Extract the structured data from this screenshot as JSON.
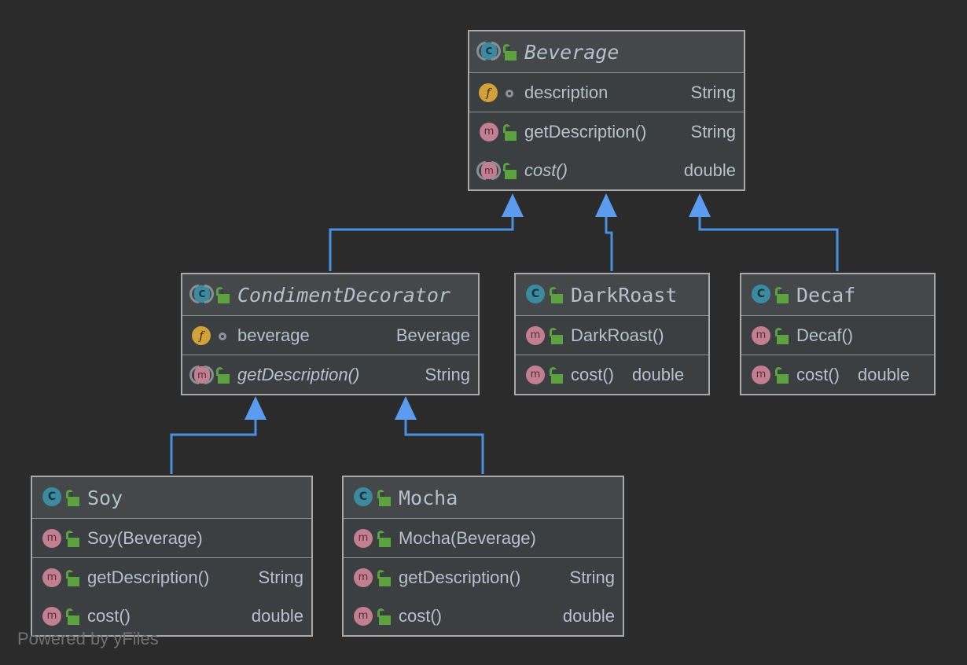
{
  "diagram": {
    "type": "uml-class-diagram",
    "background_color": "#2b2b2b",
    "box_fill": "#3c3f41",
    "header_fill": "#45484a",
    "border_color": "#a9a9a9",
    "edge_color": "#4a90e2",
    "text_color": "#b7c0cc",
    "watermark": "Powered by yFiles"
  },
  "icons": {
    "class": "class-icon",
    "abstract_class": "abstract-class-icon",
    "method": "method-icon",
    "abstract_method": "abstract-method-icon",
    "field": "field-icon",
    "public": "open-padlock-icon",
    "protected": "protected-ring-icon"
  },
  "classes": [
    {
      "id": "beverage",
      "name": "Beverage",
      "abstract": true,
      "visibility": "public",
      "sections": [
        {
          "members": [
            {
              "name": "description",
              "type": "String",
              "kind": "field",
              "visibility": "protected",
              "abstract": false
            }
          ]
        },
        {
          "members": [
            {
              "name": "getDescription()",
              "type": "String",
              "kind": "method",
              "visibility": "public",
              "abstract": false
            },
            {
              "name": "cost()",
              "type": "double",
              "kind": "method",
              "visibility": "public",
              "abstract": true
            }
          ]
        }
      ]
    },
    {
      "id": "condimentdecorator",
      "name": "CondimentDecorator",
      "abstract": true,
      "visibility": "public",
      "sections": [
        {
          "members": [
            {
              "name": "beverage",
              "type": "Beverage",
              "kind": "field",
              "visibility": "protected",
              "abstract": false
            }
          ]
        },
        {
          "members": [
            {
              "name": "getDescription()",
              "type": "String",
              "kind": "method",
              "visibility": "public",
              "abstract": true
            }
          ]
        }
      ]
    },
    {
      "id": "darkroast",
      "name": "DarkRoast",
      "abstract": false,
      "visibility": "public",
      "sections": [
        {
          "members": [
            {
              "name": "DarkRoast()",
              "type": "",
              "kind": "method",
              "visibility": "public",
              "abstract": false
            }
          ]
        },
        {
          "members": [
            {
              "name": "cost()",
              "type": "double",
              "kind": "method",
              "visibility": "public",
              "abstract": false
            }
          ]
        }
      ]
    },
    {
      "id": "decaf",
      "name": "Decaf",
      "abstract": false,
      "visibility": "public",
      "sections": [
        {
          "members": [
            {
              "name": "Decaf()",
              "type": "",
              "kind": "method",
              "visibility": "public",
              "abstract": false
            }
          ]
        },
        {
          "members": [
            {
              "name": "cost()",
              "type": "double",
              "kind": "method",
              "visibility": "public",
              "abstract": false
            }
          ]
        }
      ]
    },
    {
      "id": "soy",
      "name": "Soy",
      "abstract": false,
      "visibility": "public",
      "sections": [
        {
          "members": [
            {
              "name": "Soy(Beverage)",
              "type": "",
              "kind": "method",
              "visibility": "public",
              "abstract": false
            }
          ]
        },
        {
          "members": [
            {
              "name": "getDescription()",
              "type": "String",
              "kind": "method",
              "visibility": "public",
              "abstract": false
            },
            {
              "name": "cost()",
              "type": "double",
              "kind": "method",
              "visibility": "public",
              "abstract": false
            }
          ]
        }
      ]
    },
    {
      "id": "mocha",
      "name": "Mocha",
      "abstract": false,
      "visibility": "public",
      "sections": [
        {
          "members": [
            {
              "name": "Mocha(Beverage)",
              "type": "",
              "kind": "method",
              "visibility": "public",
              "abstract": false
            }
          ]
        },
        {
          "members": [
            {
              "name": "getDescription()",
              "type": "String",
              "kind": "method",
              "visibility": "public",
              "abstract": false
            },
            {
              "name": "cost()",
              "type": "double",
              "kind": "method",
              "visibility": "public",
              "abstract": false
            }
          ]
        }
      ]
    }
  ],
  "relationships": [
    {
      "type": "generalization",
      "from": "condimentdecorator",
      "to": "beverage"
    },
    {
      "type": "generalization",
      "from": "darkroast",
      "to": "beverage"
    },
    {
      "type": "generalization",
      "from": "decaf",
      "to": "beverage"
    },
    {
      "type": "generalization",
      "from": "soy",
      "to": "condimentdecorator"
    },
    {
      "type": "generalization",
      "from": "mocha",
      "to": "condimentdecorator"
    }
  ]
}
